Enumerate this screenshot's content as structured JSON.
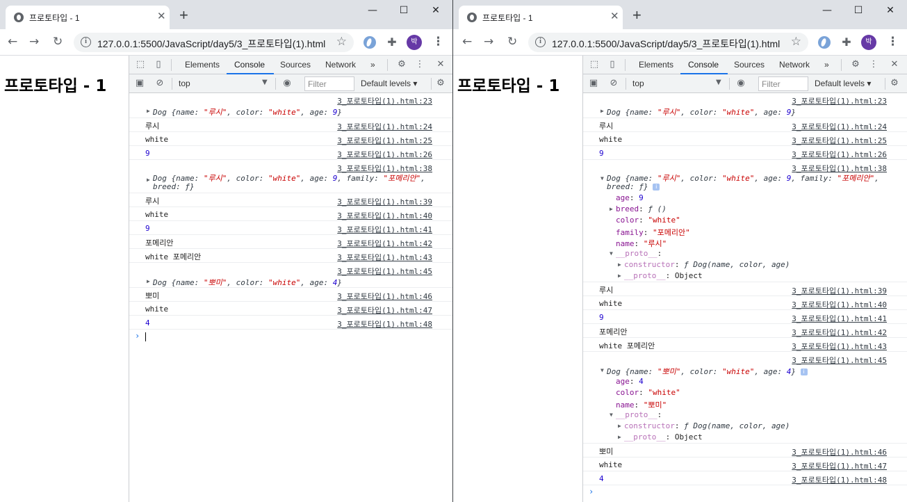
{
  "tab_title": "프로토타입 - 1",
  "tab_close": "✕",
  "new_tab": "+",
  "win_min": "—",
  "win_max": "☐",
  "win_close": "✕",
  "nav_back": "←",
  "nav_forward": "→",
  "nav_reload": "↻",
  "url": "127.0.0.1:5500/JavaScript/day5/3_프로토타입(1).html",
  "avatar_letter": "박",
  "menu": "⋮",
  "page_heading": "프로토타입 - 1",
  "devtools": {
    "tabs": [
      "Elements",
      "Console",
      "Sources",
      "Network"
    ],
    "more": "»",
    "context": "top",
    "filter_placeholder": "Filter",
    "levels": "Default levels ▾"
  },
  "src": {
    "l23": "3_포로토타입(1).html:23",
    "l24": "3_포로토타입(1).html:24",
    "l25": "3_포로토타입(1).html:25",
    "l26": "3_포로토타입(1).html:26",
    "l38": "3_포로토타입(1).html:38",
    "l39": "3_포로토타입(1).html:39",
    "l40": "3_포로토타입(1).html:40",
    "l41": "3_포로토타입(1).html:41",
    "l42": "3_포로토타입(1).html:42",
    "l43": "3_포로토타입(1).html:43",
    "l45": "3_포로토타입(1).html:45",
    "l46": "3_포로토타입(1).html:46",
    "l47": "3_포로토타입(1).html:47",
    "l48": "3_포로토타입(1).html:48"
  },
  "text": {
    "lusi": "루시",
    "white": "white",
    "nine": "9",
    "pomeranian": "포메리안",
    "white_pom": "white 포메리안",
    "bbomi": "뽀미",
    "four": "4"
  },
  "obj": {
    "dog1": "Dog {name: ",
    "dog1_name": "\"루시\"",
    "dog1_color_k": ", color: ",
    "dog1_color": "\"white\"",
    "dog1_age_k": ", age: ",
    "dog1_age": "9",
    "dog1_end": "}",
    "dog2_family_k": ", family: ",
    "dog2_family": "\"포메리안\"",
    "dog2_tail": ",",
    "dog2_breed": "breed: ƒ}",
    "dog3_name": "\"뽀미\"",
    "dog3_age": "4"
  },
  "expanded": {
    "age_k": "age",
    "age_9": "9",
    "breed_k": "breed",
    "breed_v": "ƒ ()",
    "color_k": "color",
    "color_v": "\"white\"",
    "family_k": "family",
    "family_v": "\"포메리안\"",
    "name_k": "name",
    "name_lusi": "\"루시\"",
    "proto_k": "__proto__",
    "ctor_k": "constructor",
    "ctor_v": "ƒ Dog(name, color, age)",
    "object_v": "Object",
    "age_4": "4",
    "name_bbomi": "\"뽀미\""
  },
  "prompt": "›"
}
